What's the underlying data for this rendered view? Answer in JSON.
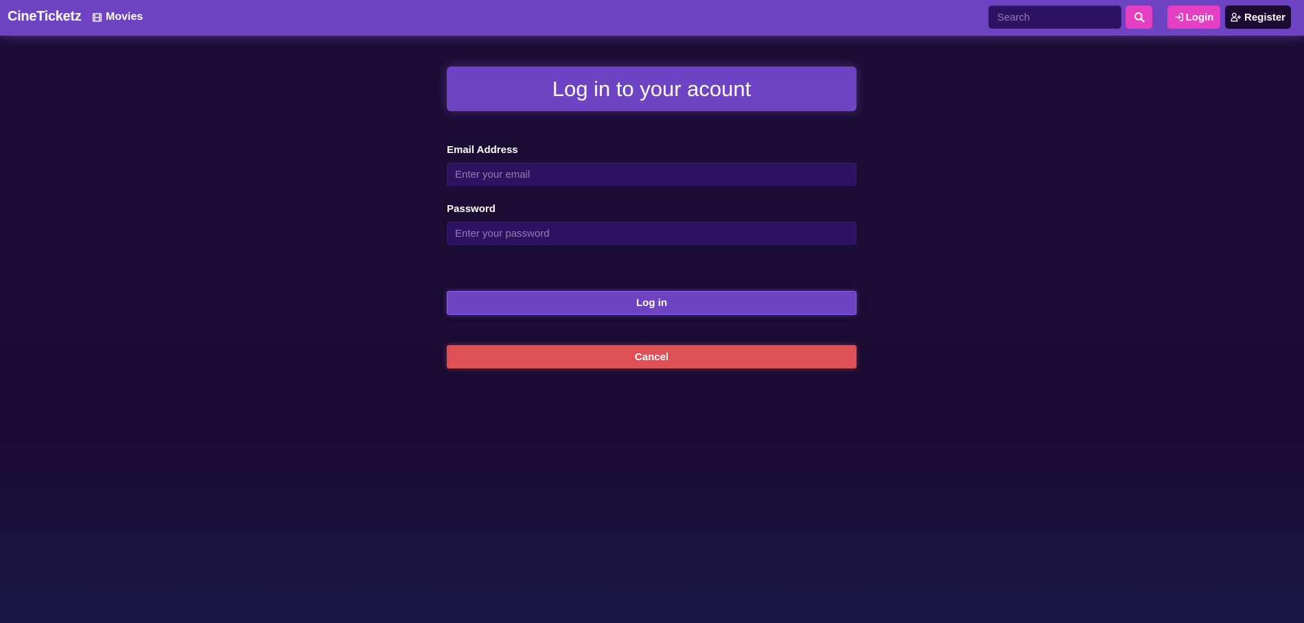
{
  "navbar": {
    "brand": "CineTicketz",
    "movies_label": "Movies",
    "movies_icon": "film-icon",
    "search_placeholder": "Search",
    "search_icon": "search-icon",
    "login_label": "Login",
    "login_icon": "sign-in-icon",
    "register_label": "Register",
    "register_icon": "user-plus-icon"
  },
  "form": {
    "title": "Log in to your acount",
    "email_label": "Email Address",
    "email_placeholder": "Enter your email",
    "email_value": "",
    "password_label": "Password",
    "password_placeholder": "Enter your password",
    "password_value": "",
    "submit_label": "Log in",
    "cancel_label": "Cancel"
  },
  "colors": {
    "navbar_bg": "#6f44c4",
    "page_bg": "#1b0b33",
    "accent_pink": "#e43fc3",
    "input_bg": "#2c1261",
    "cancel_red": "#dd5055"
  }
}
